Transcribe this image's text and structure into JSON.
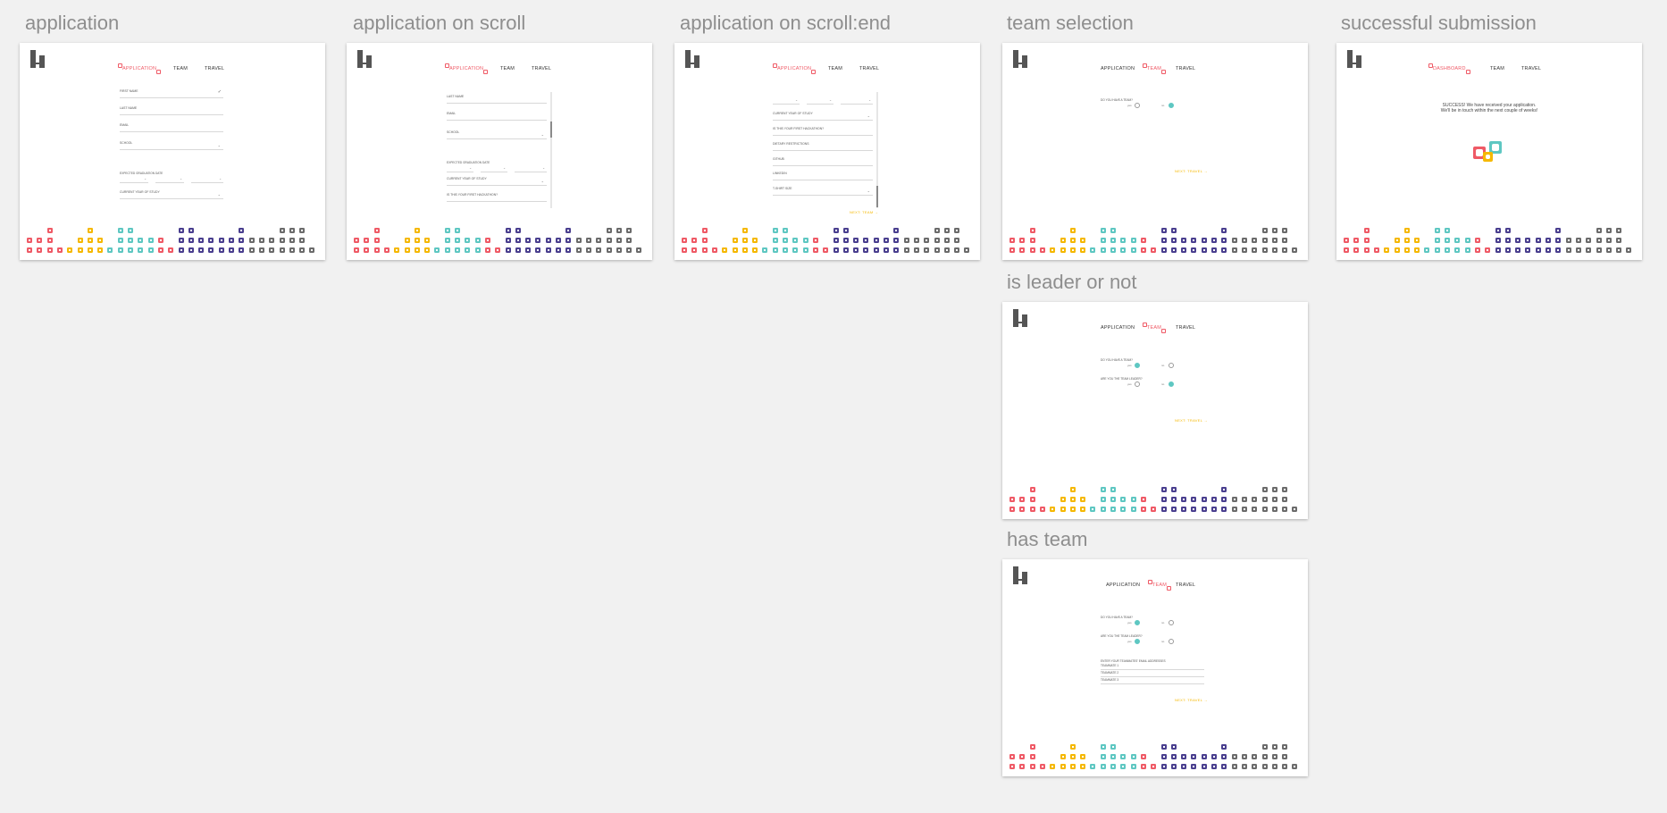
{
  "colors": {
    "red": "#ef5a66",
    "yellow": "#f5b800",
    "teal": "#5ec7c2",
    "purple": "#4a3f8f",
    "gray": "#6b6b6b",
    "canvas": "#f1f1f1"
  },
  "labels": {
    "application": "application",
    "on_scroll": "application on scroll",
    "scroll_end": "application on scroll:end",
    "team_selection": "team selection",
    "success": "successful submission",
    "leader": "is leader or not",
    "has_team": "has team"
  },
  "nav": {
    "application": "APPLICATION",
    "team": "TEAM",
    "travel": "TRAVEL",
    "dashboard": "DASHBOARD"
  },
  "form": {
    "first_name": "FIRST NAME",
    "last_name": "LAST NAME",
    "email": "EMAIL",
    "school": "SCHOOL",
    "grad_date": "EXPECTED GRADUATION DATE",
    "year_of_study": "CURRENT YEAR OF STUDY",
    "is_first_hackathon": "IS THIS YOUR FIRST HACKATHON?",
    "resume": "RESUME",
    "github": "GITHUB",
    "linkedin": "LINKEDIN",
    "tshirt": "T-SHIRT SIZE",
    "dietary": "DIETARY RESTRICTIONS"
  },
  "team": {
    "has_team_q": "DO YOU HAVE A TEAM?",
    "leader_q": "ARE YOU THE TEAM LEADER?",
    "yes": "yes",
    "no": "no",
    "members_heading": "ENTER YOUR TEAMMATES' EMAIL ADDRESSES",
    "member1": "TEAMMATE 1",
    "member2": "TEAMMATE 2",
    "member3": "TEAMMATE 3",
    "next_travel": "NEXT: TRAVEL",
    "next_team": "NEXT: TEAM"
  },
  "success": {
    "line1": "SUCCESS! We have received your application.",
    "line2": "We'll be in touch within the next couple of weeks!"
  }
}
